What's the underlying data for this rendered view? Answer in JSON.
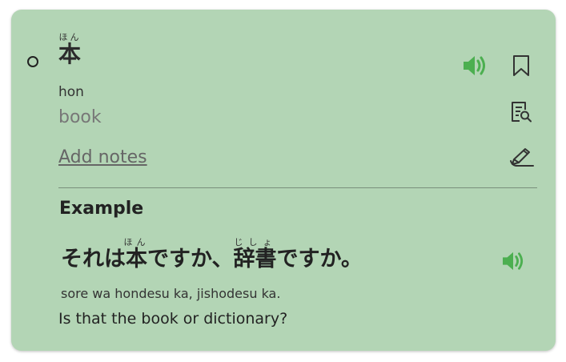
{
  "entry": {
    "furigana": "ほん",
    "kanji": "本",
    "romaji": "hon",
    "meaning": "book",
    "notes_link": "Add notes"
  },
  "example": {
    "title": "Example",
    "parts": {
      "pre": "それは",
      "kanji1": "本",
      "furigana1": "ほん",
      "mid": "ですか、",
      "kanji2": "辞書",
      "furigana2": "じしょ",
      "post": "ですか。"
    },
    "romaji": "sore wa hondesu ka, jishodesu ka.",
    "translation": "Is that the book or dictionary?"
  },
  "icons": {
    "speaker": "speaker-icon",
    "bookmark": "bookmark-icon",
    "lookup": "dictionary-search-icon",
    "handwriting": "handwriting-icon"
  },
  "colors": {
    "card_bg": "#b3d5b5",
    "accent_green": "#4caf50"
  }
}
